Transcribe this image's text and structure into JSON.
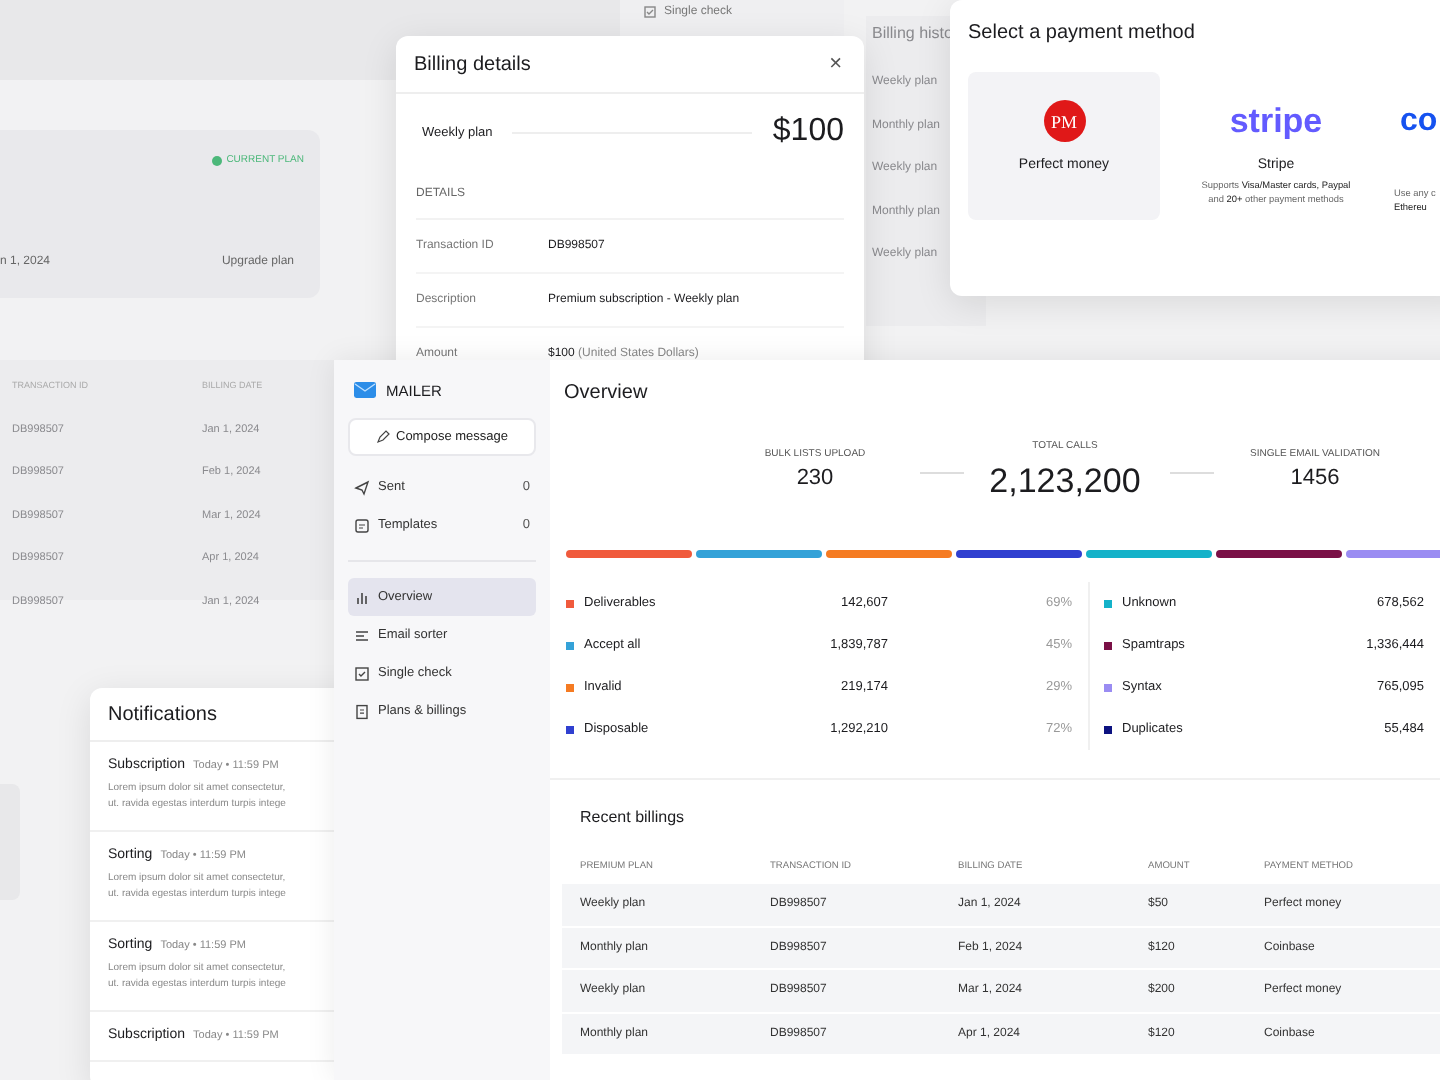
{
  "background": {
    "sidebar_item": "Single check",
    "plan_card": {
      "badge": "CURRENT PLAN",
      "date": "n 1, 2024",
      "action": "Upgrade plan"
    },
    "history_table": {
      "columns": [
        "TRANSACTION ID",
        "BILLING DATE"
      ],
      "rows": [
        [
          "DB998507",
          "Jan 1, 2024"
        ],
        [
          "DB998507",
          "Feb 1, 2024"
        ],
        [
          "DB998507",
          "Mar 1, 2024"
        ],
        [
          "DB998507",
          "Apr 1, 2024"
        ],
        [
          "DB998507",
          "Jan 1, 2024"
        ]
      ]
    },
    "billing_history": {
      "title": "Billing histo",
      "rows": [
        "Weekly plan",
        "Monthly plan",
        "Weekly plan",
        "Monthly plan",
        "Weekly plan"
      ]
    }
  },
  "billing_details": {
    "title": "Billing details",
    "close": "×",
    "plan": "Weekly plan",
    "price": "$100",
    "section": "DETAILS",
    "rows": [
      {
        "label": "Transaction ID",
        "value": "DB998507"
      },
      {
        "label": "Description",
        "value": "Premium subscription - Weekly plan"
      },
      {
        "label": "Amount",
        "value": "$100",
        "note": "(United States Dollars)"
      }
    ]
  },
  "payment_method": {
    "title": "Select a payment method",
    "methods": [
      {
        "kind": "badge",
        "logo": "PM",
        "name": "Perfect money",
        "selected": true
      },
      {
        "kind": "wordmark",
        "logo": "stripe",
        "name": "Stripe",
        "description": [
          "Supports **Visa/Master cards, Paypal**",
          "and **20+** other payment methods"
        ],
        "selected": false
      },
      {
        "kind": "wordmark",
        "logo": "co",
        "description": [
          "Use any c",
          "**Ethereu**"
        ],
        "selected": false
      }
    ]
  },
  "notifications": {
    "title": "Notifications",
    "items": [
      {
        "title": "Subscription",
        "time": "Today • 11:59 PM",
        "text": [
          "Lorem ipsum dolor sit amet consectetur,",
          "ut. ravida egestas interdum turpis intege"
        ]
      },
      {
        "title": "Sorting",
        "time": "Today • 11:59 PM",
        "text": [
          "Lorem ipsum dolor sit amet consectetur,",
          "ut. ravida egestas interdum turpis intege"
        ]
      },
      {
        "title": "Sorting",
        "time": "Today • 11:59 PM",
        "text": [
          "Lorem ipsum dolor sit amet consectetur,",
          "ut. ravida egestas interdum turpis intege"
        ]
      },
      {
        "title": "Subscription",
        "time": "Today • 11:59 PM"
      }
    ]
  },
  "app": {
    "brand": "MAILER",
    "compose": "Compose message",
    "folders": [
      {
        "kind": "send",
        "label": "Sent",
        "count": "0"
      },
      {
        "kind": "template",
        "label": "Templates",
        "count": "0"
      }
    ],
    "nav": [
      {
        "kind": "chart",
        "label": "Overview",
        "selected": true
      },
      {
        "kind": "sorter",
        "label": "Email sorter",
        "selected": false
      },
      {
        "kind": "check",
        "label": "Single check",
        "selected": false
      },
      {
        "kind": "doc",
        "label": "Plans & billings",
        "selected": false
      }
    ],
    "title": "Overview",
    "stats": [
      {
        "kind": "side",
        "label": "BULK LISTS UPLOAD",
        "value": "230"
      },
      {
        "kind": "main",
        "label": "TOTAL CALLS",
        "value": "2,123,200"
      },
      {
        "kind": "side",
        "label": "SINGLE EMAIL VALIDATION",
        "value": "1456"
      }
    ],
    "legend": [
      [
        {
          "label": "Deliverables",
          "value": "142,607",
          "percent": "69%",
          "color": "#f05a3c"
        },
        {
          "label": "Accept all",
          "value": "1,839,787",
          "percent": "45%",
          "color": "#34a2d8"
        },
        {
          "label": "Invalid",
          "value": "219,174",
          "percent": "29%",
          "color": "#f57b22"
        },
        {
          "label": "Disposable",
          "value": "1,292,210",
          "percent": "72%",
          "color": "#3040d0"
        }
      ],
      [
        {
          "label": "Unknown",
          "value": "678,562",
          "color": "#14b2c9"
        },
        {
          "label": "Spamtraps",
          "value": "1,336,444",
          "color": "#7a1046"
        },
        {
          "label": "Syntax",
          "value": "765,095",
          "color": "#9a8cf2"
        },
        {
          "label": "Duplicates",
          "value": "55,484",
          "color": "#0c1280"
        }
      ]
    ],
    "billings": {
      "title": "Recent billings",
      "columns": [
        "PREMIUM PLAN",
        "TRANSACTION ID",
        "BILLING DATE",
        "AMOUNT",
        "PAYMENT METHOD"
      ],
      "rows": [
        [
          "Weekly plan",
          "DB998507",
          "Jan 1, 2024",
          "$50",
          "Perfect money"
        ],
        [
          "Monthly plan",
          "DB998507",
          "Feb 1, 2024",
          "$120",
          "Coinbase"
        ],
        [
          "Weekly plan",
          "DB998507",
          "Mar 1, 2024",
          "$200",
          "Perfect money"
        ],
        [
          "Monthly plan",
          "DB998507",
          "Apr 1, 2024",
          "$120",
          "Coinbase"
        ]
      ]
    }
  }
}
